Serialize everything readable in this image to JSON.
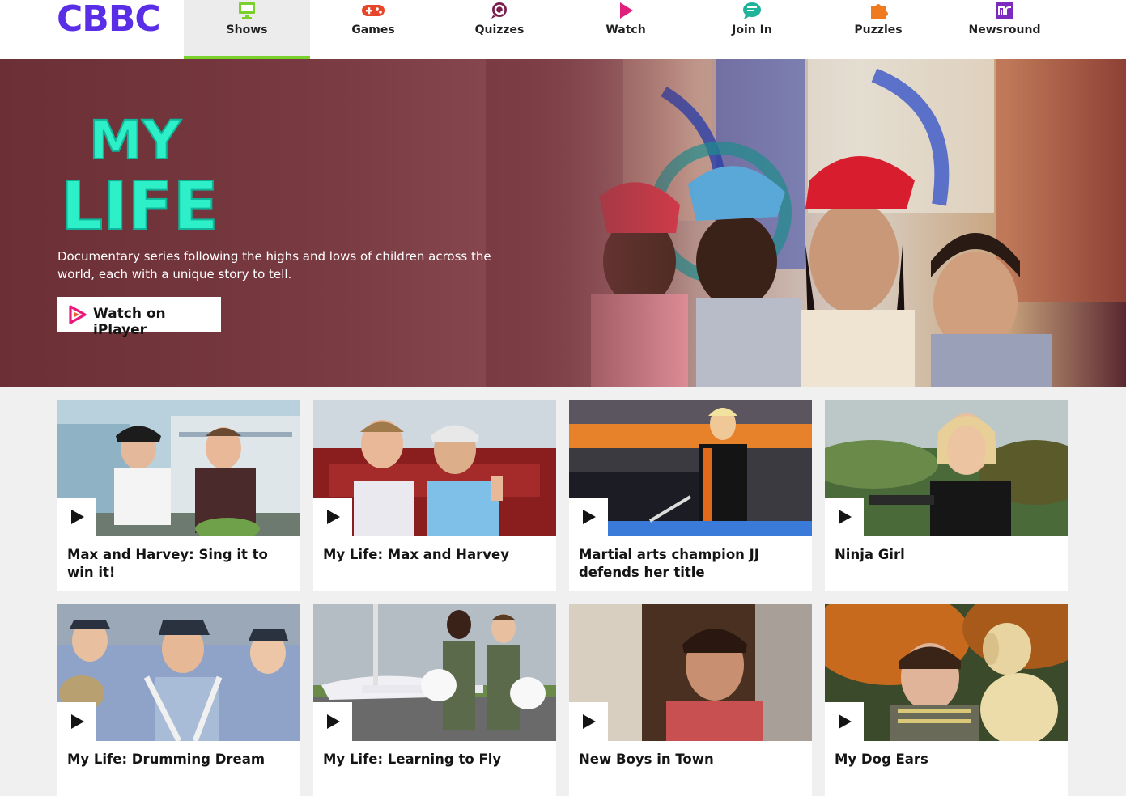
{
  "nav": {
    "logo": "CBBC",
    "items": [
      {
        "label": "Shows",
        "icon": "tv-icon",
        "color": "#7bd12b"
      },
      {
        "label": "Games",
        "icon": "gamepad-icon",
        "color": "#e8462b"
      },
      {
        "label": "Quizzes",
        "icon": "quiz-icon",
        "color": "#7a1e4c"
      },
      {
        "label": "Watch",
        "icon": "play-icon",
        "color": "#e0207a"
      },
      {
        "label": "Join In",
        "icon": "chat-icon",
        "color": "#1fb39a"
      },
      {
        "label": "Puzzles",
        "icon": "puzzle-icon",
        "color": "#f07b1e"
      },
      {
        "label": "Newsround",
        "icon": "newsround-icon",
        "color": "#7b2cbf"
      }
    ],
    "active": "Shows"
  },
  "hero": {
    "show_logo_line1": "MY",
    "show_logo_line2": "LIFE",
    "description": "Documentary series following the highs and lows of children across the world, each with a unique story to tell.",
    "button_label": "Watch on iPlayer",
    "colors": {
      "background": "#7a3b42",
      "logo": "#2ef0c8"
    }
  },
  "episodes": [
    {
      "title": "Max and Harvey: Sing it to win it!"
    },
    {
      "title": "My Life: Max and Harvey"
    },
    {
      "title": "Martial arts champion JJ defends her title"
    },
    {
      "title": "Ninja Girl"
    },
    {
      "title": "My Life: Drumming Dream"
    },
    {
      "title": "My Life: Learning to Fly"
    },
    {
      "title": "New Boys in Town"
    },
    {
      "title": "My Dog Ears"
    }
  ],
  "colors": {
    "brand": "#5a2de6",
    "active_underline": "#7bd12b",
    "page_bg": "#f0f0f0"
  }
}
